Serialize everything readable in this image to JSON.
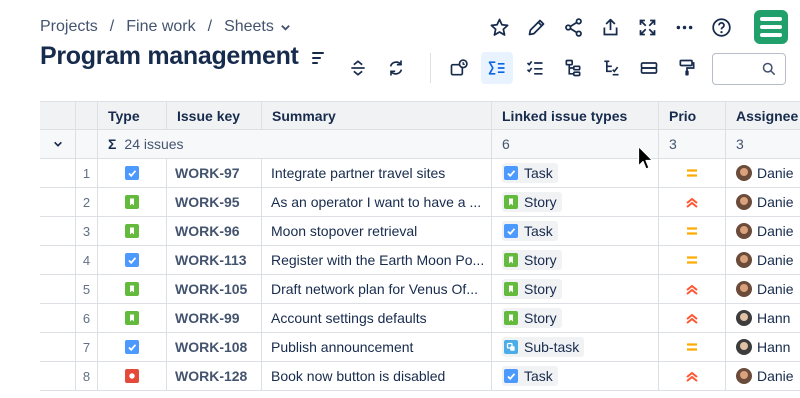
{
  "breadcrumb": {
    "items": [
      "Projects",
      "Fine work",
      "Sheets"
    ],
    "separator": "/"
  },
  "page": {
    "title": "Program management"
  },
  "search": {
    "placeholder": ""
  },
  "table": {
    "columns": [
      "Type",
      "Issue key",
      "Summary",
      "Linked issue types",
      "Prio",
      "Assignee"
    ],
    "group": {
      "sigma": "Σ",
      "count_label": "24 issues",
      "linked_count": "6",
      "prio_count": "3",
      "assignee_count": "3"
    },
    "rows": [
      {
        "n": "1",
        "type": "task",
        "key": "WORK-97",
        "summary": "Integrate partner travel sites",
        "linked_type": "task",
        "linked": "Task",
        "prio": "medium",
        "assignee": "Danie",
        "avatar": "a"
      },
      {
        "n": "2",
        "type": "story",
        "key": "WORK-95",
        "summary": "As an operator I want to have a ...",
        "linked_type": "story",
        "linked": "Story",
        "prio": "high",
        "assignee": "Danie",
        "avatar": "a"
      },
      {
        "n": "3",
        "type": "story",
        "key": "WORK-96",
        "summary": "Moon stopover retrieval",
        "linked_type": "task",
        "linked": "Task",
        "prio": "medium",
        "assignee": "Danie",
        "avatar": "a"
      },
      {
        "n": "4",
        "type": "task",
        "key": "WORK-113",
        "summary": "Register with the Earth Moon Po...",
        "linked_type": "story",
        "linked": "Story",
        "prio": "medium",
        "assignee": "Danie",
        "avatar": "a"
      },
      {
        "n": "5",
        "type": "story",
        "key": "WORK-105",
        "summary": "Draft network plan for Venus Of...",
        "linked_type": "story",
        "linked": "Story",
        "prio": "high",
        "assignee": "Danie",
        "avatar": "a"
      },
      {
        "n": "6",
        "type": "story",
        "key": "WORK-99",
        "summary": "Account settings defaults",
        "linked_type": "story",
        "linked": "Story",
        "prio": "high",
        "assignee": "Hann",
        "avatar": "b"
      },
      {
        "n": "7",
        "type": "task",
        "key": "WORK-108",
        "summary": "Publish announcement",
        "linked_type": "subtask",
        "linked": "Sub-task",
        "prio": "medium",
        "assignee": "Hann",
        "avatar": "b"
      },
      {
        "n": "8",
        "type": "bug",
        "key": "WORK-128",
        "summary": "Book now button is disabled",
        "linked_type": "task",
        "linked": "Task",
        "prio": "high",
        "assignee": "Danie",
        "avatar": "a"
      }
    ]
  },
  "colors": {
    "task": "#4c9aff",
    "story": "#63ba3c",
    "bug": "#e5493a",
    "subtask": "#4bade8",
    "prio_medium": "#ffab00",
    "prio_high": "#ff5630",
    "logo": "#22a06b",
    "active_tool": "#e9f2ff"
  },
  "icons": {
    "top": [
      "star-icon",
      "pencil-icon",
      "share-icon",
      "export-icon",
      "fullscreen-icon",
      "more-icon",
      "help-icon"
    ],
    "toolbar": [
      "row-height-icon",
      "refresh-icon",
      "add-field-icon",
      "sum-icon",
      "checklist-icon",
      "hierarchy-icon",
      "filter-icon",
      "group-icon",
      "paint-roller-icon"
    ]
  }
}
